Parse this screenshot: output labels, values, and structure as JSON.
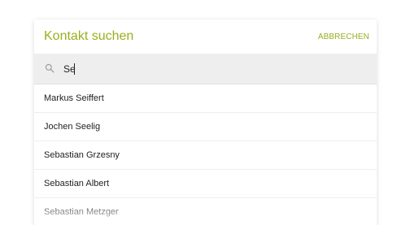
{
  "dialog": {
    "title": "Kontakt suchen",
    "cancel_label": "ABBRECHEN",
    "accent_color": "#9bae1f"
  },
  "search": {
    "value": "Se",
    "icon": "search-icon"
  },
  "results": [
    {
      "label": "Markus Seiffert"
    },
    {
      "label": "Jochen Seelig"
    },
    {
      "label": "Sebastian Grzesny"
    },
    {
      "label": "Sebastian Albert"
    },
    {
      "label": "Sebastian Metzger"
    }
  ]
}
